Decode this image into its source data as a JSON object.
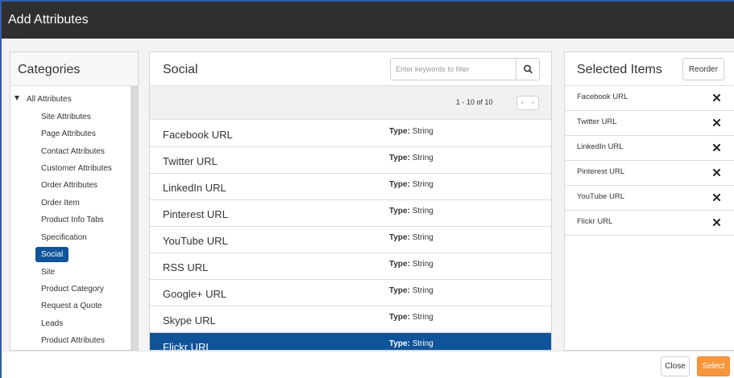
{
  "dialog": {
    "title": "Add Attributes"
  },
  "categories": {
    "heading": "Categories",
    "root": "All Attributes",
    "items": [
      "Site Attributes",
      "Page Attributes",
      "Contact Attributes",
      "Customer Attributes",
      "Order Attributes",
      "Order Item",
      "Product Info Tabs",
      "Specification",
      "Social",
      "Site",
      "Product Category",
      "Request a Quote",
      "Leads",
      "Product Attributes"
    ],
    "active": "Social"
  },
  "attributes": {
    "heading": "Social",
    "search_placeholder": "Enter keywords to filter",
    "pager_text": "1 - 10 of 10",
    "type_label": "Type:",
    "rows": [
      {
        "name": "Facebook URL",
        "type": "String"
      },
      {
        "name": "Twitter URL",
        "type": "String"
      },
      {
        "name": "LinkedIn URL",
        "type": "String"
      },
      {
        "name": "Pinterest URL",
        "type": "String"
      },
      {
        "name": "YouTube URL",
        "type": "String"
      },
      {
        "name": "RSS URL",
        "type": "String"
      },
      {
        "name": "Google+ URL",
        "type": "String"
      },
      {
        "name": "Skype URL",
        "type": "String"
      },
      {
        "name": "Flickr URL",
        "type": "String"
      }
    ],
    "selected_row": "Flickr URL"
  },
  "selected_items": {
    "heading": "Selected Items",
    "reorder_label": "Reorder",
    "items": [
      "Facebook URL",
      "Twitter URL",
      "LinkedIn URL",
      "Pinterest URL",
      "YouTube URL",
      "Flickr URL"
    ]
  },
  "footer": {
    "close_label": "Close",
    "select_label": "Select"
  },
  "colors": {
    "accent": "#0f5499",
    "primary_button": "#f7963c",
    "titlebar": "#2f2f2f"
  }
}
